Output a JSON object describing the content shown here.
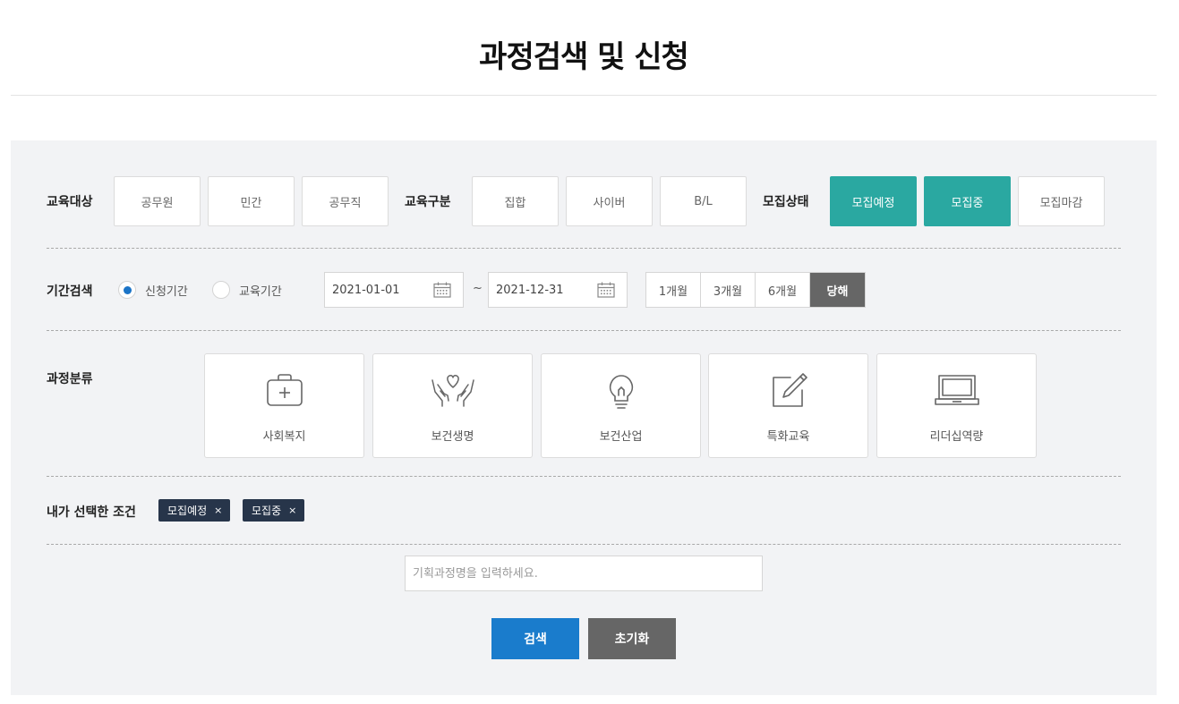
{
  "page": {
    "title": "과정검색 및 신청"
  },
  "filters": {
    "target": {
      "label": "교육대상",
      "options": [
        {
          "label": "공무원",
          "selected": false
        },
        {
          "label": "민간",
          "selected": false
        },
        {
          "label": "공무직",
          "selected": false
        }
      ]
    },
    "type": {
      "label": "교육구분",
      "options": [
        {
          "label": "집합",
          "selected": false
        },
        {
          "label": "사이버",
          "selected": false
        },
        {
          "label": "B/L",
          "selected": false
        }
      ]
    },
    "status": {
      "label": "모집상태",
      "options": [
        {
          "label": "모집예정",
          "selected": true
        },
        {
          "label": "모집중",
          "selected": true
        },
        {
          "label": "모집마감",
          "selected": false
        }
      ]
    }
  },
  "period": {
    "label": "기간검색",
    "radios": [
      {
        "label": "신청기간",
        "checked": true
      },
      {
        "label": "교육기간",
        "checked": false
      }
    ],
    "start_date": "2021-01-01",
    "separator": "~",
    "end_date": "2021-12-31",
    "quick_ranges": [
      {
        "label": "1개월",
        "active": false
      },
      {
        "label": "3개월",
        "active": false
      },
      {
        "label": "6개월",
        "active": false
      },
      {
        "label": "당해",
        "active": true
      }
    ]
  },
  "categories": {
    "label": "과정분류",
    "items": [
      {
        "label": "사회복지",
        "icon": "first-aid-kit-icon"
      },
      {
        "label": "보건생명",
        "icon": "hands-heart-icon"
      },
      {
        "label": "보건산업",
        "icon": "light-bulb-icon"
      },
      {
        "label": "특화교육",
        "icon": "edit-pencil-icon"
      },
      {
        "label": "리더십역량",
        "icon": "laptop-icon"
      }
    ]
  },
  "selected_conditions": {
    "label": "내가 선택한 조건",
    "tags": [
      {
        "label": "모집예정",
        "remove": "×"
      },
      {
        "label": "모집중",
        "remove": "×"
      }
    ]
  },
  "search": {
    "placeholder": "기획과정명을 입력하세요.",
    "search_label": "검색",
    "reset_label": "초기화"
  },
  "colors": {
    "accent_teal": "#2aa8a1",
    "primary_blue": "#1a7ccc",
    "tag_navy": "#27354a",
    "neutral_dark": "#666666",
    "panel_bg": "#f2f3f5"
  }
}
